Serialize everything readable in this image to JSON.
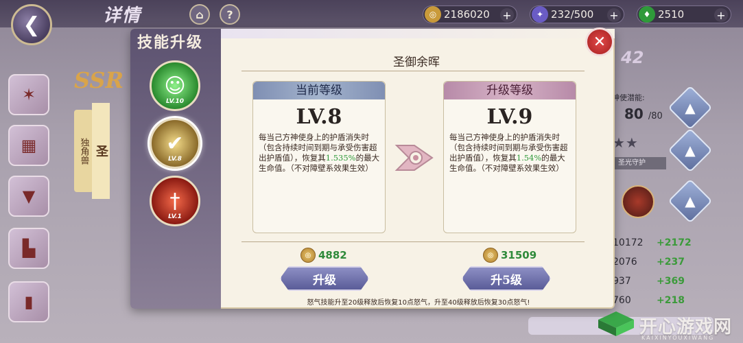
{
  "topbar": {
    "title": "详情",
    "back_icon": "back-arrow-icon",
    "home_icon": "home-icon",
    "help_label": "?",
    "resources": [
      {
        "icon": "gold-coin-icon",
        "value": "2186020"
      },
      {
        "icon": "stamina-icon",
        "value": "232/500"
      },
      {
        "icon": "gem-icon",
        "value": "2510"
      }
    ],
    "plus_label": "+"
  },
  "background": {
    "rarity": "SSR",
    "banner_small": "独角兽",
    "banner_main": "圣",
    "power_partial": "42",
    "potential_label": "神使潜能:",
    "potential_value": "80",
    "potential_max": "/80",
    "tag_label": "圣光守护",
    "stats": [
      {
        "value": "10172",
        "delta": "+2172"
      },
      {
        "value": "2076",
        "delta": "+237"
      },
      {
        "value": "937",
        "delta": "+369"
      },
      {
        "value": "760",
        "delta": "+218"
      }
    ]
  },
  "watermark": {
    "text": "开心游戏网",
    "sub": "KAIXINYOUXIWANG"
  },
  "modal": {
    "title": "技能升级",
    "close_icon": "close-icon",
    "skills": [
      {
        "icon": "person-shield-icon",
        "level": "LV.10"
      },
      {
        "icon": "shield-check-icon",
        "level": "LV.8"
      },
      {
        "icon": "sword-icon",
        "level": "LV.1"
      }
    ],
    "skill_name": "圣御余晖",
    "current": {
      "header": "当前等级",
      "level": "LV.8",
      "desc_a": "每当己方神使身上的护盾消失时（包含持续时间到期与承受伤害超出护盾值），恢复其",
      "desc_pct": "1.535%",
      "desc_b": "的最大生命值。（不对障壁系效果生效）"
    },
    "next": {
      "header": "升级等级",
      "level": "LV.9",
      "desc_a": "每当己方神使身上的护盾消失时（包含持续时间到期与承受伤害超出护盾值），恢复其",
      "desc_pct": "1.54%",
      "desc_b": "的最大生命值。（不对障壁系效果生效）"
    },
    "cost_single": "4882",
    "cost_multi": "31509",
    "btn_single": "升级",
    "btn_multi": "升5级",
    "footnote": "怒气技能升至20级释放后恢复10点怒气，升至40级释放后恢复30点怒气!"
  },
  "colors": {
    "accent_green": "#2f9a3a",
    "close_red": "#d63a3a",
    "button_purple": "#6a6ca8"
  }
}
